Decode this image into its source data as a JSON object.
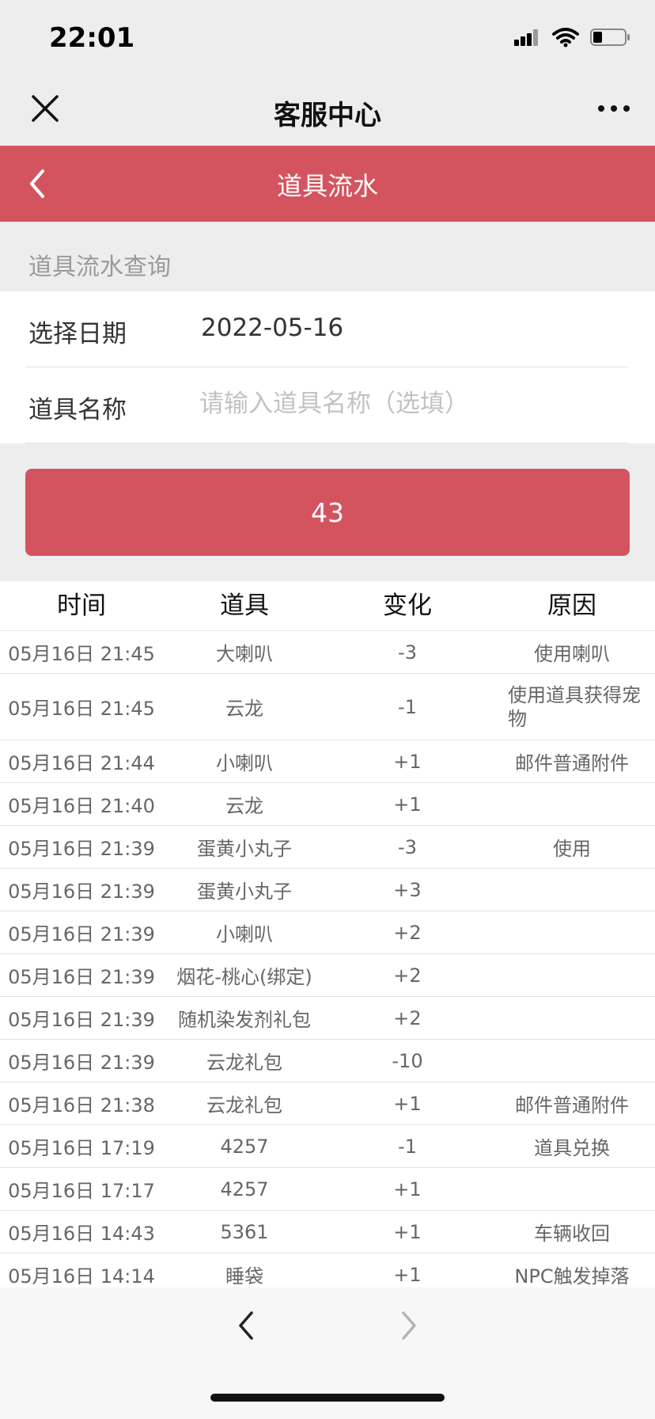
{
  "status": {
    "time": "22:01"
  },
  "nav": {
    "title": "客服中心"
  },
  "header": {
    "title": "道具流水"
  },
  "section": {
    "label": "道具流水查询"
  },
  "form": {
    "date_label": "选择日期",
    "date_value": "2022-05-16",
    "item_label": "道具名称",
    "item_placeholder": "请输入道具名称（选填）"
  },
  "query_button": {
    "label": "43"
  },
  "table": {
    "headers": [
      "时间",
      "道具",
      "变化",
      "原因"
    ],
    "rows": [
      {
        "time": "05月16日 21:45",
        "item": "大喇叭",
        "change": "-3",
        "reason": "使用喇叭"
      },
      {
        "time": "05月16日 21:45",
        "item": "云龙",
        "change": "-1",
        "reason": "使用道具获得宠物"
      },
      {
        "time": "05月16日 21:44",
        "item": "小喇叭",
        "change": "+1",
        "reason": "邮件普通附件"
      },
      {
        "time": "05月16日 21:40",
        "item": "云龙",
        "change": "+1",
        "reason": ""
      },
      {
        "time": "05月16日 21:39",
        "item": "蛋黄小丸子",
        "change": "-3",
        "reason": "使用"
      },
      {
        "time": "05月16日 21:39",
        "item": "蛋黄小丸子",
        "change": "+3",
        "reason": ""
      },
      {
        "time": "05月16日 21:39",
        "item": "小喇叭",
        "change": "+2",
        "reason": ""
      },
      {
        "time": "05月16日 21:39",
        "item": "烟花-桃心(绑定)",
        "change": "+2",
        "reason": ""
      },
      {
        "time": "05月16日 21:39",
        "item": "随机染发剂礼包",
        "change": "+2",
        "reason": ""
      },
      {
        "time": "05月16日 21:39",
        "item": "云龙礼包",
        "change": "-10",
        "reason": ""
      },
      {
        "time": "05月16日 21:38",
        "item": "云龙礼包",
        "change": "+1",
        "reason": "邮件普通附件"
      },
      {
        "time": "05月16日 17:19",
        "item": "4257",
        "change": "-1",
        "reason": "道具兑换"
      },
      {
        "time": "05月16日 17:17",
        "item": "4257",
        "change": "+1",
        "reason": ""
      },
      {
        "time": "05月16日 14:43",
        "item": "5361",
        "change": "+1",
        "reason": "车辆收回"
      },
      {
        "time": "05月16日 14:14",
        "item": "睡袋",
        "change": "+1",
        "reason": "NPC触发掉落"
      }
    ]
  },
  "icons": {
    "close": "close-icon",
    "more": "more-icon",
    "back": "chevron-left-icon",
    "prev": "chevron-left-icon",
    "next": "chevron-right-icon"
  },
  "colors": {
    "accent": "#d3545f",
    "background": "#ededed"
  }
}
